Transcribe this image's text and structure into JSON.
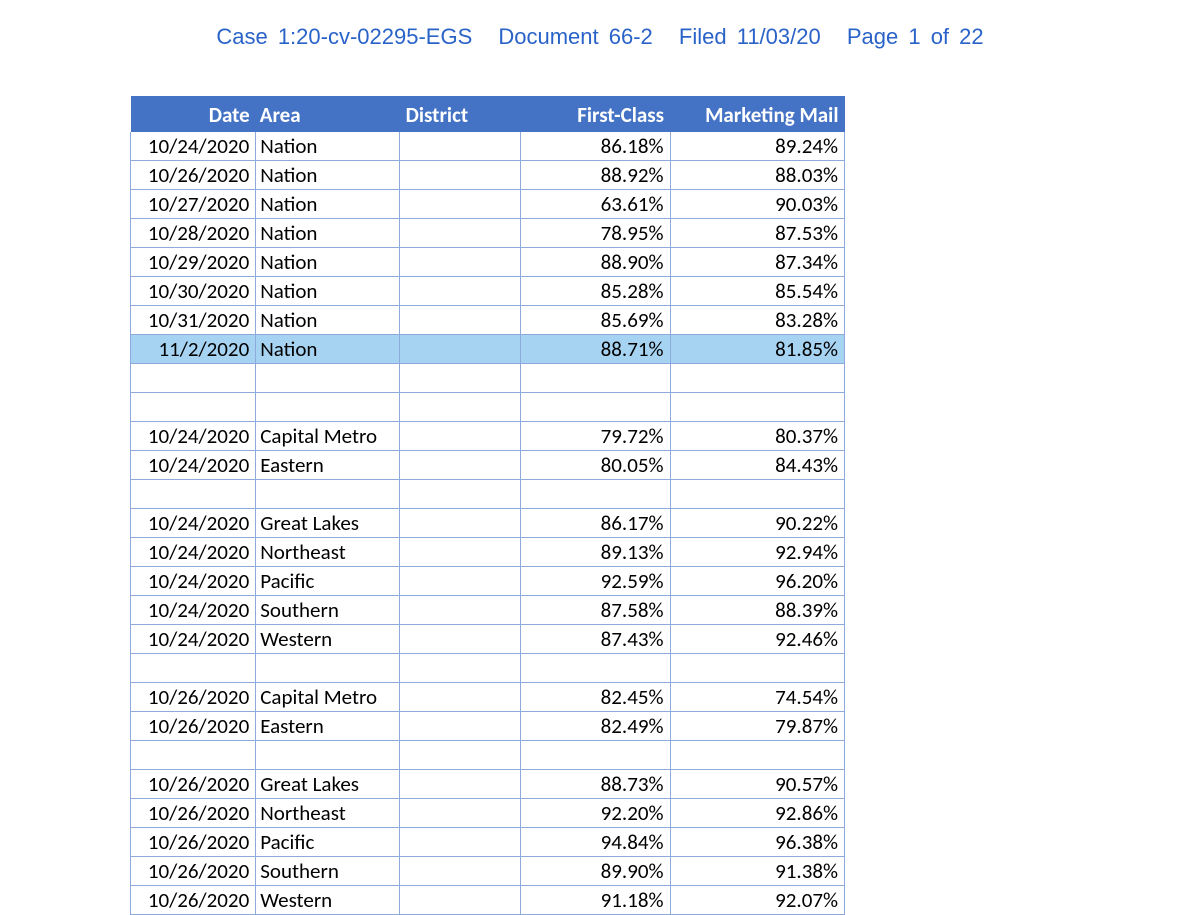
{
  "header": {
    "case": "Case 1:20-cv-02295-EGS",
    "doc": "Document 66-2",
    "filed": "Filed 11/03/20",
    "page": "Page 1 of 22"
  },
  "columns": {
    "date": "Date",
    "area": "Area",
    "district": "District",
    "first": "First-Class",
    "mkt": "Marketing Mail"
  },
  "rows": [
    {
      "date": "10/24/2020",
      "area": "Nation",
      "district": "",
      "first": "86.18%",
      "mkt": "89.24%",
      "hl": false
    },
    {
      "date": "10/26/2020",
      "area": "Nation",
      "district": "",
      "first": "88.92%",
      "mkt": "88.03%",
      "hl": false
    },
    {
      "date": "10/27/2020",
      "area": "Nation",
      "district": "",
      "first": "63.61%",
      "mkt": "90.03%",
      "hl": false
    },
    {
      "date": "10/28/2020",
      "area": "Nation",
      "district": "",
      "first": "78.95%",
      "mkt": "87.53%",
      "hl": false
    },
    {
      "date": "10/29/2020",
      "area": "Nation",
      "district": "",
      "first": "88.90%",
      "mkt": "87.34%",
      "hl": false
    },
    {
      "date": "10/30/2020",
      "area": "Nation",
      "district": "",
      "first": "85.28%",
      "mkt": "85.54%",
      "hl": false
    },
    {
      "date": "10/31/2020",
      "area": "Nation",
      "district": "",
      "first": "85.69%",
      "mkt": "83.28%",
      "hl": false
    },
    {
      "date": "11/2/2020",
      "area": "Nation",
      "district": "",
      "first": "88.71%",
      "mkt": "81.85%",
      "hl": true
    },
    {
      "blank": true
    },
    {
      "blank": true
    },
    {
      "date": "10/24/2020",
      "area": "Capital Metro",
      "district": "",
      "first": "79.72%",
      "mkt": "80.37%",
      "hl": false
    },
    {
      "date": "10/24/2020",
      "area": "Eastern",
      "district": "",
      "first": "80.05%",
      "mkt": "84.43%",
      "hl": false
    },
    {
      "blank": true
    },
    {
      "date": "10/24/2020",
      "area": "Great Lakes",
      "district": "",
      "first": "86.17%",
      "mkt": "90.22%",
      "hl": false
    },
    {
      "date": "10/24/2020",
      "area": "Northeast",
      "district": "",
      "first": "89.13%",
      "mkt": "92.94%",
      "hl": false
    },
    {
      "date": "10/24/2020",
      "area": "Pacific",
      "district": "",
      "first": "92.59%",
      "mkt": "96.20%",
      "hl": false
    },
    {
      "date": "10/24/2020",
      "area": "Southern",
      "district": "",
      "first": "87.58%",
      "mkt": "88.39%",
      "hl": false
    },
    {
      "date": "10/24/2020",
      "area": "Western",
      "district": "",
      "first": "87.43%",
      "mkt": "92.46%",
      "hl": false
    },
    {
      "blank": true
    },
    {
      "date": "10/26/2020",
      "area": "Capital Metro",
      "district": "",
      "first": "82.45%",
      "mkt": "74.54%",
      "hl": false
    },
    {
      "date": "10/26/2020",
      "area": "Eastern",
      "district": "",
      "first": "82.49%",
      "mkt": "79.87%",
      "hl": false
    },
    {
      "blank": true
    },
    {
      "date": "10/26/2020",
      "area": "Great Lakes",
      "district": "",
      "first": "88.73%",
      "mkt": "90.57%",
      "hl": false
    },
    {
      "date": "10/26/2020",
      "area": "Northeast",
      "district": "",
      "first": "92.20%",
      "mkt": "92.86%",
      "hl": false
    },
    {
      "date": "10/26/2020",
      "area": "Pacific",
      "district": "",
      "first": "94.84%",
      "mkt": "96.38%",
      "hl": false
    },
    {
      "date": "10/26/2020",
      "area": "Southern",
      "district": "",
      "first": "89.90%",
      "mkt": "91.38%",
      "hl": false
    },
    {
      "date": "10/26/2020",
      "area": "Western",
      "district": "",
      "first": "91.18%",
      "mkt": "92.07%",
      "hl": false
    }
  ]
}
